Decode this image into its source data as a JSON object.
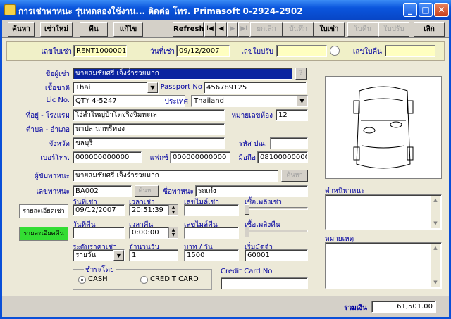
{
  "window": {
    "title": "การเช่าพาหนะ รุ่นทดลองใช้งาน... ติดต่อ โทร. Primasoft 0-2924-2902",
    "min": "_",
    "max": "□",
    "close": "✕"
  },
  "toolbar": {
    "search": "ค้นหา",
    "new": "เช่าใหม่",
    "return": "คืน",
    "edit": "แก้ไข",
    "refresh": "Refresh",
    "nav_first": "I◀",
    "nav_prev": "◀",
    "nav_next": "▶",
    "nav_last": "▶I",
    "cancel": "ยกเลิก",
    "save": "บันทึก",
    "rent_slip": "ใบเช่า",
    "return_slip": "ใบคืน",
    "fine_slip": "ใบปรับ",
    "exit": "เลิก"
  },
  "docbar": {
    "rent_no_label": "เลขใบเช่า",
    "rent_no": "RENT1000001",
    "rent_date_label": "วันที่เช่า",
    "rent_date": "09/12/2007",
    "fine_no_label": "เลขใบปรับ",
    "fine_no": "",
    "return_no_label": "เลขใบคืน",
    "return_no": ""
  },
  "customer": {
    "renter_label": "ชื่อผู้เช่า",
    "renter": "นายสมชัยศรี เจ็งร่ำรวยมาก",
    "lookup_btn": "?",
    "nationality_label": "เชื้อชาติ",
    "nationality": "Thai",
    "passport_label": "Passport No",
    "passport": "456789125",
    "lic_label": "Lic No.",
    "lic": "QTY 4-5247",
    "country_label": "ประเทศ",
    "country": "Thailand",
    "address_label": "ที่อยู่ - โรงแรม",
    "address": "โง่ลำใหญ่บ้าโตจริงจิมทะเล",
    "room_label": "หมายเลขห้อง",
    "room": "12",
    "district_label": "ตำบล - อำเภอ",
    "district": "นาปล นาทรีทอง",
    "province_label": "จังหวัด",
    "province": "ชลบุรี",
    "zip_label": "รหัส ปณ.",
    "zip": "",
    "phone_label": "เบอร์โทร.",
    "phone": "000000000000",
    "fax_label": "แฟกซ์",
    "fax": "000000000000",
    "mobile_label": "มือถือ",
    "mobile": "08100000000",
    "driver_label": "ผู้ขับพาหนะ",
    "driver": "นายสมชัยศรี เจ็งร่ำรวยมาก",
    "driver_search_btn": "ค้นหา"
  },
  "vehicle": {
    "vehicle_no_label": "เลขพาหนะ",
    "vehicle_no": "BA002",
    "vehicle_search_btn": "ค้นหา",
    "vehicle_name_label": "ชื่อพาหนะ",
    "vehicle_name": "รถเก๋ง"
  },
  "rent_detail": {
    "button": "รายละเอียดเช่า",
    "date_label": "วันที่เช่า",
    "date": "09/12/2007",
    "time_label": "เวลาเช่า",
    "time": "20:51:39",
    "mile_label": "เลขไมล์เช่า",
    "mile": "",
    "fuel_label": "เชื้อเพลิงเช่า"
  },
  "return_detail": {
    "button": "รายละเอียดคืน",
    "date_label": "วันที่คืน",
    "date": "",
    "time_label": "เวลาคืน",
    "time": "0:00:00",
    "mile_label": "เลขไมล์คืน",
    "mile": "",
    "fuel_label": "เชื้อเพลิงคืน"
  },
  "pricing": {
    "level_label": "ระดับราคาเช่า",
    "level": "รายวัน",
    "days_label": "จำนวนวัน",
    "days": "1",
    "rate_label": "บาท / วัน",
    "rate": "1500",
    "start_mile_label": "เริ่มมัดจำ",
    "start_mile": "60001"
  },
  "payment": {
    "group_label": "ชำระโดย",
    "cash": "CASH",
    "credit": "CREDIT CARD",
    "selected": "CASH",
    "card_no_label": "Credit Card No",
    "card_no": ""
  },
  "notes": {
    "vehicle_defects_label": "ตำหนิพาหนะ",
    "remarks_label": "หมายเหตุ"
  },
  "total": {
    "label": "รวมเงิน",
    "value": "61,501.00"
  },
  "colors": {
    "rent_btn": "#ffffff",
    "return_btn": "#33dd33",
    "accent": "#0a55dd"
  }
}
